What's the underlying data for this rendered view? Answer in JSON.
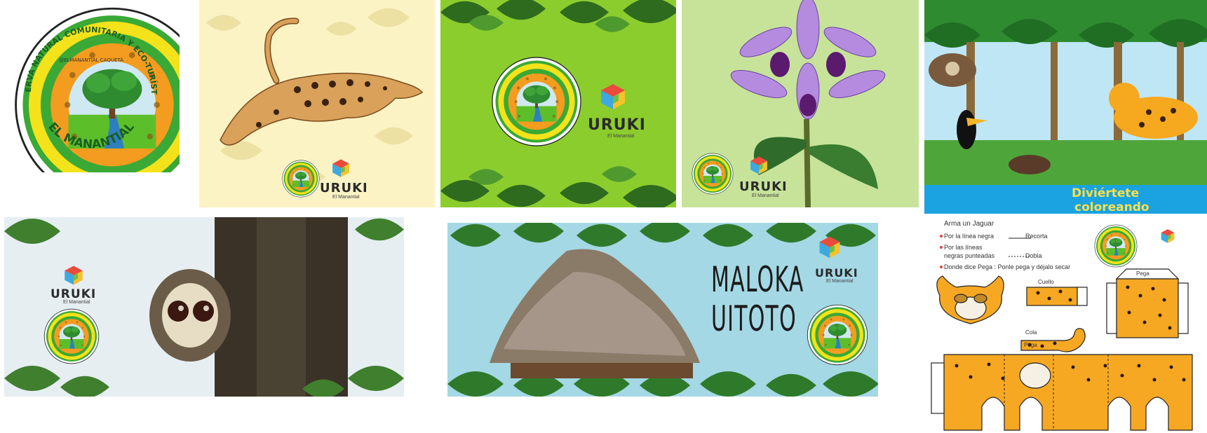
{
  "logo": {
    "arc_top": "RESERVA NATURAL COMUNITARIA Y ECO-TURÍSTICA",
    "arc_bottom": "EL MANANTIAL",
    "social": "@ELMANANTIAL CAQUETÁ"
  },
  "brand": {
    "name": "URUKI",
    "sub": "El Manantial"
  },
  "tiles": {
    "coloring": {
      "caption_1": "Diviértete",
      "caption_2": "coloreando"
    },
    "maloka": {
      "title_1": "MALOKA",
      "title_2": "UITOTO"
    },
    "craft": {
      "heading": "Arma un Jaguar",
      "step1_a": "Por la línea negra",
      "step1_b": "Recorta",
      "step2_a": "Por las líneas",
      "step2_b": "negras punteadas",
      "step2_c": "Dobla",
      "step3": "Donde dice Pega : Ponle pega y déjalo secar",
      "label_neck": "Cuello",
      "label_tail": "Cola",
      "label_glue": "Pega"
    }
  },
  "colors": {
    "logo_green": "#3aa935",
    "logo_yellow": "#f4e21a",
    "logo_orange": "#f39c1f",
    "jaguar_orange": "#f7a823",
    "leaf_green": "#3d7a2e",
    "sky_blue": "#9fd8e6",
    "coloring_bar": "#1aa3e0"
  }
}
